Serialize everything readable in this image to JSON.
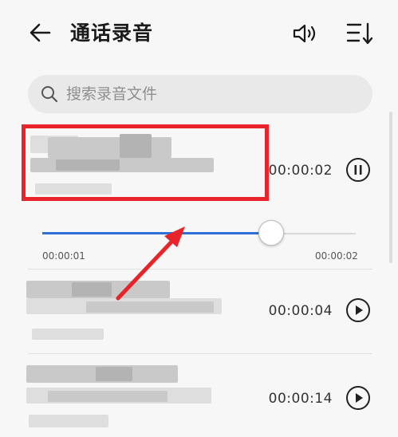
{
  "header": {
    "title": "通话录音",
    "back_icon": "back-arrow-icon",
    "speaker_icon": "speaker-icon",
    "sort_icon": "sort-icon"
  },
  "search": {
    "placeholder": "搜索录音文件",
    "icon": "search-icon"
  },
  "recordings": [
    {
      "duration": "00:00:02",
      "state": "playing",
      "control_icon": "pause-icon"
    },
    {
      "duration": "00:00:04",
      "state": "paused",
      "control_icon": "play-icon"
    },
    {
      "duration": "00:00:14",
      "state": "paused",
      "control_icon": "play-icon"
    }
  ],
  "player": {
    "elapsed": "00:00:01",
    "total": "00:00:02",
    "progress": 0.73
  },
  "colors": {
    "accent": "#2e6fd6",
    "annotation": "#e8232a"
  }
}
